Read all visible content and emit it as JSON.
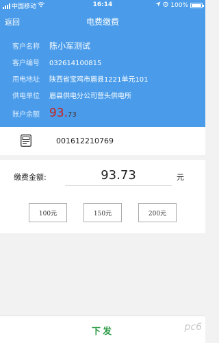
{
  "status_bar": {
    "carrier": "中国移动",
    "time": "16:14",
    "battery": "100%"
  },
  "navbar": {
    "back_label": "返回",
    "title": "电费缴费"
  },
  "customer": {
    "name_label": "客户名称",
    "name": "陈小军测试",
    "id_label": "客户编号",
    "id": "032614100815",
    "address_label": "用电地址",
    "address": "陕西省宝鸡市眉县1221单元101",
    "supplier_label": "供电单位",
    "supplier": "眉县供电分公司营头供电所",
    "balance_label": "账户余额",
    "balance_int": "93.",
    "balance_dec": "73"
  },
  "meter": {
    "icon": "meter-icon",
    "number": "001612210769"
  },
  "payment": {
    "amount_label": "缴费金额:",
    "amount_value": "93.73",
    "unit": "元",
    "quick_amounts": [
      "100元",
      "150元",
      "200元"
    ]
  },
  "footer": {
    "submit_label": "下发",
    "watermark": "pc6"
  },
  "colors": {
    "header_bg": "#4a9cea",
    "balance_accent": "#c8211f",
    "submit_text": "#2b9a46"
  }
}
